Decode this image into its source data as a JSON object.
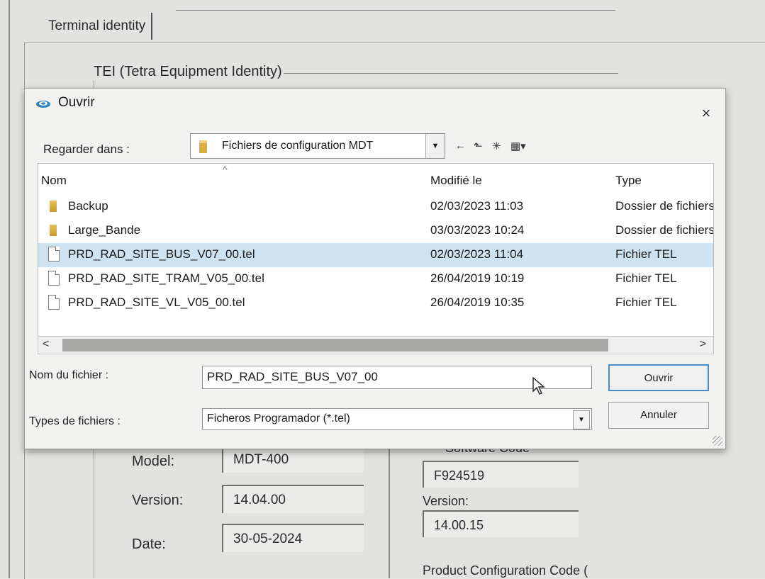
{
  "background": {
    "tab_label": "Terminal identity",
    "group_title": "TEI (Tetra Equipment Identity)",
    "fields_left": [
      {
        "label": "Model:",
        "value": "MDT-400"
      },
      {
        "label": "Version:",
        "value": "14.04.00"
      },
      {
        "label": "Date:",
        "value": "30-05-2024"
      }
    ],
    "software_code_label": "Software Code",
    "software_code_value": "F924519",
    "right_version_label": "Version:",
    "right_version_value": "14.00.15",
    "product_config_label": "Product Configuration Code ("
  },
  "dialog": {
    "title": "Ouvrir",
    "close_glyph": "×",
    "look_in_label": "Regarder dans :",
    "look_in_value": "Fichiers de configuration MDT",
    "toolbar": {
      "back": "←",
      "up": "⬑",
      "new_folder": "✳",
      "view": "▦▾"
    },
    "columns": {
      "name": "Nom",
      "modified": "Modifié le",
      "type": "Type",
      "sort_indicator": "^"
    },
    "rows": [
      {
        "name": "Backup",
        "modified": "02/03/2023 11:03",
        "type": "Dossier de fichiers",
        "icon": "folder-icon",
        "selected": false
      },
      {
        "name": "Large_Bande",
        "modified": "03/03/2023 10:24",
        "type": "Dossier de fichiers",
        "icon": "folder-icon",
        "selected": false
      },
      {
        "name": "PRD_RAD_SITE_BUS_V07_00.tel",
        "modified": "02/03/2023 11:04",
        "type": "Fichier TEL",
        "icon": "file-icon",
        "selected": true
      },
      {
        "name": "PRD_RAD_SITE_TRAM_V05_00.tel",
        "modified": "26/04/2019 10:19",
        "type": "Fichier TEL",
        "icon": "file-icon",
        "selected": false
      },
      {
        "name": "PRD_RAD_SITE_VL_V05_00.tel",
        "modified": "26/04/2019 10:35",
        "type": "Fichier TEL",
        "icon": "file-icon",
        "selected": false
      }
    ],
    "scroll": {
      "left": "<",
      "right": ">"
    },
    "filename_label": "Nom du fichier :",
    "filename_value": "PRD_RAD_SITE_BUS_V07_00",
    "filetype_label": "Types de fichiers :",
    "filetype_value": "Ficheros Programador (*.tel)",
    "open_button": "Ouvrir",
    "cancel_button": "Annuler",
    "colors": {
      "selection": "#cfe2ef",
      "default_button_border": "#4a8cc7",
      "folder": "#d9ae3f"
    }
  }
}
